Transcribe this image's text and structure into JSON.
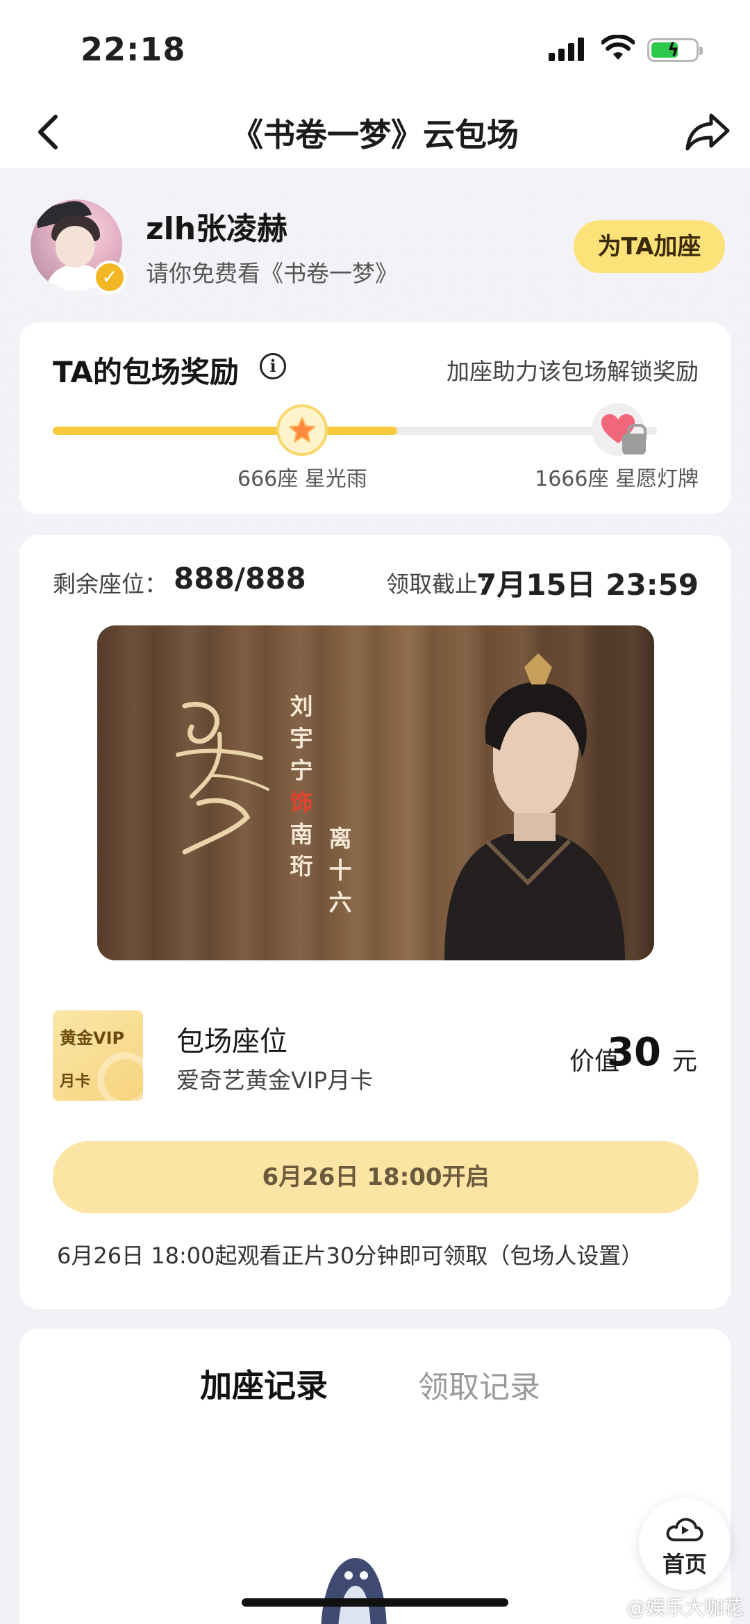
{
  "status_bar": {
    "time": "22:18"
  },
  "nav": {
    "title": "《书卷一梦》云包场"
  },
  "host": {
    "name": "zlh张凌赫",
    "invite": "请你免费看《书卷一梦》",
    "add_seat_label": "为TA加座"
  },
  "reward": {
    "title": "TA的包场奖励",
    "hint": "加座助力该包场解锁奖励",
    "progress": 0.57,
    "milestones": [
      {
        "label": "666座 星光雨",
        "unlocked": true
      },
      {
        "label": "1666座 星愿灯牌",
        "unlocked": false
      }
    ]
  },
  "main": {
    "seats_label": "剩余座位：",
    "seats_value": "888/888",
    "deadline_label": "领取截止：",
    "deadline_value": "7月15日 23:59",
    "poster": {
      "cast_line": "刘宇宁",
      "role_mark": "饰",
      "role_1": "南珩",
      "role_2": "离十六"
    },
    "vip": {
      "card_line1": "黄金VIP",
      "card_line2": "月卡",
      "title": "包场座位",
      "desc": "爱奇艺黄金VIP月卡",
      "value_label": "价值",
      "value_num": "30",
      "value_unit": "元"
    },
    "open_button": "6月26日 18:00开启",
    "open_note": "6月26日 18:00起观看正片30分钟即可领取（包场人设置）"
  },
  "records": {
    "tabs": [
      "加座记录",
      "领取记录"
    ]
  },
  "home_button": {
    "label": "首页"
  },
  "watermark": "@娱乐大咖花",
  "colors": {
    "accent_yellow": "#fde27a",
    "progress_yellow": "#f7c93c",
    "button_light_yellow": "#fbe4a4",
    "verified_gold": "#f2b722"
  }
}
